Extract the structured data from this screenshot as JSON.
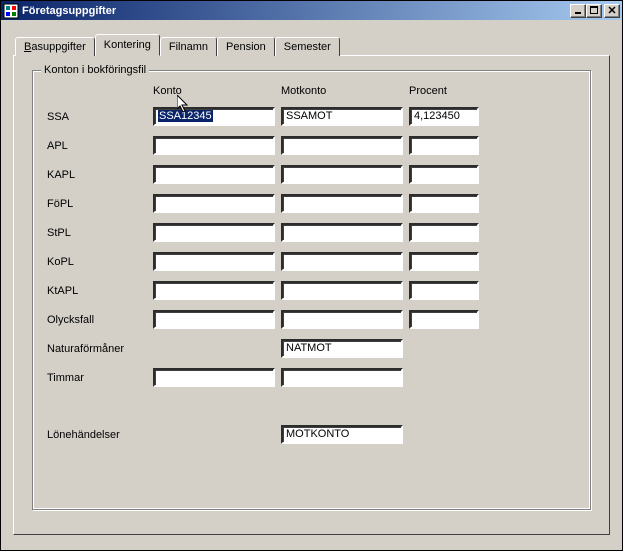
{
  "window": {
    "title": "Företagsuppgifter"
  },
  "tabs": {
    "t0": "Basuppgifter",
    "t1": "Kontering",
    "t2": "Filnamn",
    "t3": "Pension",
    "t4": "Semester"
  },
  "group": {
    "legend": "Konton i bokföringsfil",
    "head_konto": "Konto",
    "head_motkonto": "Motkonto",
    "head_procent": "Procent"
  },
  "rows": {
    "ssa": {
      "label": "SSA",
      "konto": "SSA12345",
      "motkonto": "SSAMOT",
      "procent": "4,123450"
    },
    "apl": {
      "label": "APL",
      "konto": "",
      "motkonto": "",
      "procent": ""
    },
    "kapl": {
      "label": "KAPL",
      "konto": "",
      "motkonto": "",
      "procent": ""
    },
    "fopl": {
      "label": "FöPL",
      "konto": "",
      "motkonto": "",
      "procent": ""
    },
    "stpl": {
      "label": "StPL",
      "konto": "",
      "motkonto": "",
      "procent": ""
    },
    "kopl": {
      "label": "KoPL",
      "konto": "",
      "motkonto": "",
      "procent": ""
    },
    "ktapl": {
      "label": "KtAPL",
      "konto": "",
      "motkonto": "",
      "procent": ""
    },
    "olycks": {
      "label": "Olycksfall",
      "konto": "",
      "motkonto": "",
      "procent": ""
    },
    "natura": {
      "label": "Naturaförmåner",
      "motkonto": "NATMOT"
    },
    "timmar": {
      "label": "Timmar",
      "konto": "",
      "motkonto": ""
    },
    "lone": {
      "label": "Lönehändelser",
      "motkonto": "MOTKONTO"
    }
  }
}
